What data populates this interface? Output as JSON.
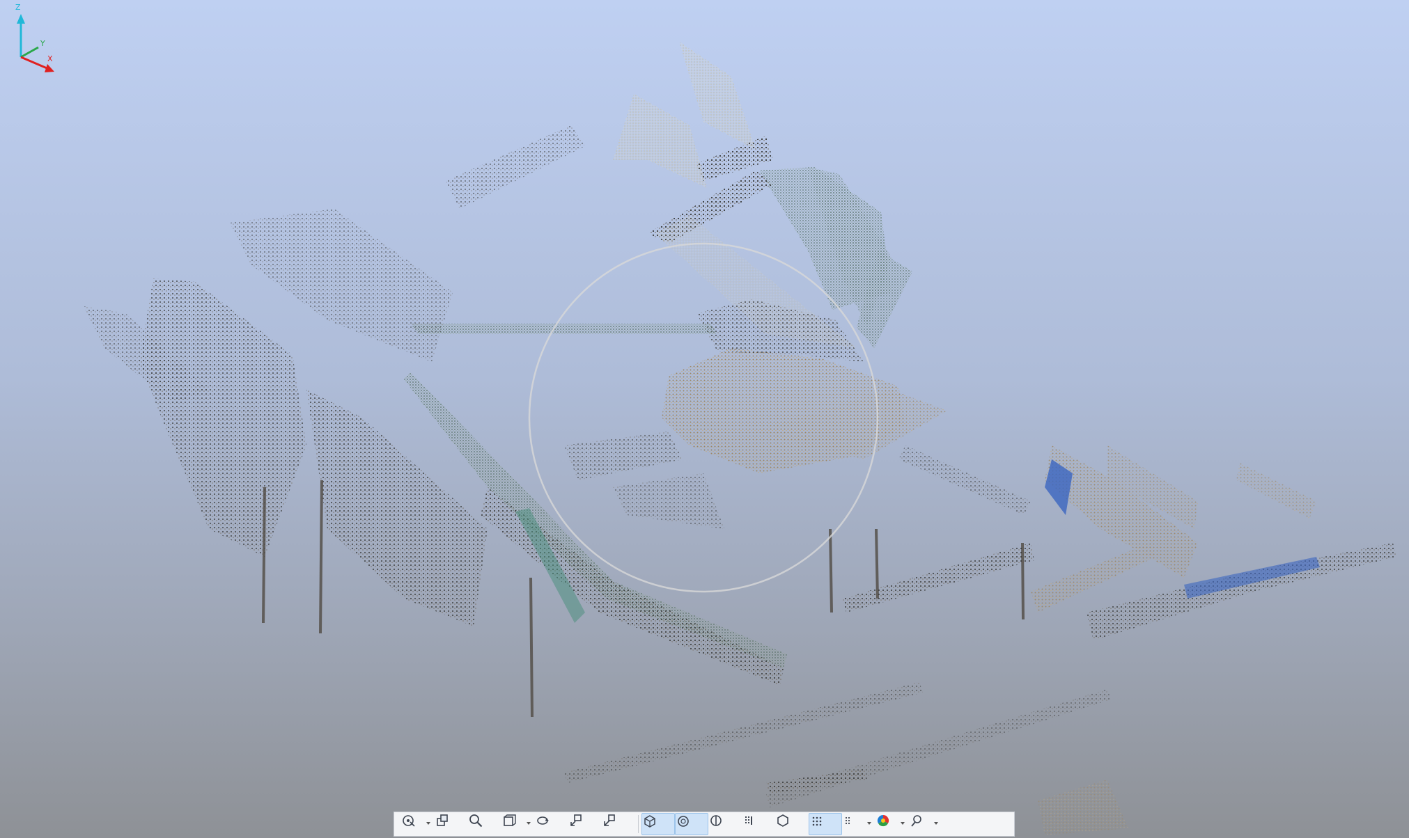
{
  "viewport": {
    "name": "point-cloud-3d-view"
  },
  "colors": {
    "sky_top": "#bfd0f2",
    "sky_bottom": "#8e9196",
    "cloud_tan": "#a78e6c",
    "cloud_dark": "#3a3a36",
    "cloud_green": "#5f7a68",
    "cloud_blue": "#2d5bbf",
    "axis_x": "#e02020",
    "axis_y": "#2aa84a",
    "axis_z": "#20b8d8"
  },
  "axis_gizmo": {
    "z_label": "Z",
    "y_label": "Y",
    "x_label": "X"
  },
  "toolbar": {
    "buttons": [
      {
        "name": "orbit-mode-button",
        "icon": "orbit-cursor-icon",
        "dropdown": true,
        "active": false
      },
      {
        "name": "pan-button",
        "icon": "pan-hand-icon",
        "dropdown": false,
        "active": false
      },
      {
        "name": "zoom-button",
        "icon": "magnifier-icon",
        "dropdown": false,
        "active": false
      },
      {
        "name": "view-cube-button",
        "icon": "cube-face-icon",
        "dropdown": true,
        "active": false
      },
      {
        "name": "rotate-view-button",
        "icon": "rotate-arrows-icon",
        "dropdown": false,
        "active": false
      },
      {
        "name": "fit-view-button",
        "icon": "fit-extents-icon",
        "dropdown": false,
        "active": false
      },
      {
        "name": "walk-mode-button",
        "icon": "walk-icon",
        "dropdown": false,
        "active": false
      },
      {
        "name": "perspective-button",
        "icon": "perspective-cube-icon",
        "dropdown": false,
        "active": true
      },
      {
        "name": "orbit-target-button",
        "icon": "target-sphere-icon",
        "dropdown": false,
        "active": true
      },
      {
        "name": "section-button",
        "icon": "section-circle-icon",
        "dropdown": false,
        "active": false
      },
      {
        "name": "point-density-button",
        "icon": "density-grid-icon",
        "dropdown": false,
        "active": false
      },
      {
        "name": "isolate-button",
        "icon": "hexagon-icon",
        "dropdown": false,
        "active": false
      },
      {
        "name": "point-display-button",
        "icon": "dot-grid-icon",
        "dropdown": false,
        "active": true
      },
      {
        "name": "point-size-button",
        "icon": "dot-grid-small-icon",
        "dropdown": true,
        "active": false
      },
      {
        "name": "color-mode-button",
        "icon": "color-sphere-icon",
        "dropdown": true,
        "active": false
      },
      {
        "name": "display-style-button",
        "icon": "paint-style-icon",
        "dropdown": true,
        "active": false
      }
    ]
  }
}
